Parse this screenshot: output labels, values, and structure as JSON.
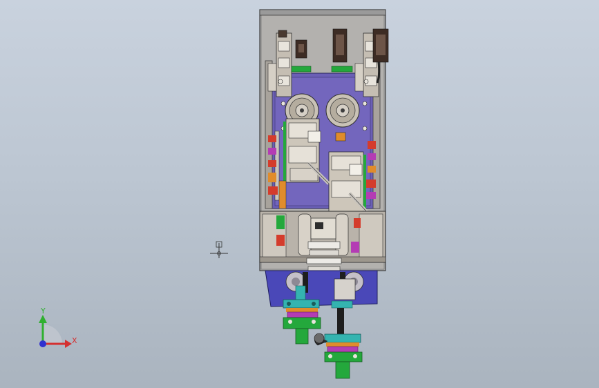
{
  "viewport": {
    "background_top": "#c9d2de",
    "background_bottom": "#aab4bf",
    "model": {
      "frame_color": "#9f9f9f",
      "plate_color": "#6a5cb4",
      "lower_block_color": "#4a48b8",
      "accent_green": "#24a83c",
      "accent_teal": "#34b4b0",
      "accent_magenta": "#b43cb4",
      "accent_red": "#d43c2c",
      "accent_orange": "#e08c2c",
      "connector_color": "#3a2a22"
    }
  },
  "triad": {
    "x_label": "X",
    "y_label": "Y",
    "x_color": "#d43030",
    "y_color": "#30b030",
    "z_color": "#3030d0"
  }
}
